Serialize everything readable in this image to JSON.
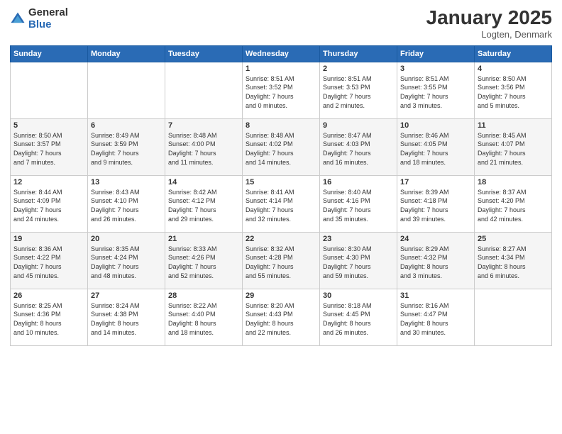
{
  "logo": {
    "general": "General",
    "blue": "Blue"
  },
  "header": {
    "title": "January 2025",
    "subtitle": "Logten, Denmark"
  },
  "days_of_week": [
    "Sunday",
    "Monday",
    "Tuesday",
    "Wednesday",
    "Thursday",
    "Friday",
    "Saturday"
  ],
  "weeks": [
    [
      {
        "day": "",
        "info": ""
      },
      {
        "day": "",
        "info": ""
      },
      {
        "day": "",
        "info": ""
      },
      {
        "day": "1",
        "info": "Sunrise: 8:51 AM\nSunset: 3:52 PM\nDaylight: 7 hours\nand 0 minutes."
      },
      {
        "day": "2",
        "info": "Sunrise: 8:51 AM\nSunset: 3:53 PM\nDaylight: 7 hours\nand 2 minutes."
      },
      {
        "day": "3",
        "info": "Sunrise: 8:51 AM\nSunset: 3:55 PM\nDaylight: 7 hours\nand 3 minutes."
      },
      {
        "day": "4",
        "info": "Sunrise: 8:50 AM\nSunset: 3:56 PM\nDaylight: 7 hours\nand 5 minutes."
      }
    ],
    [
      {
        "day": "5",
        "info": "Sunrise: 8:50 AM\nSunset: 3:57 PM\nDaylight: 7 hours\nand 7 minutes."
      },
      {
        "day": "6",
        "info": "Sunrise: 8:49 AM\nSunset: 3:59 PM\nDaylight: 7 hours\nand 9 minutes."
      },
      {
        "day": "7",
        "info": "Sunrise: 8:48 AM\nSunset: 4:00 PM\nDaylight: 7 hours\nand 11 minutes."
      },
      {
        "day": "8",
        "info": "Sunrise: 8:48 AM\nSunset: 4:02 PM\nDaylight: 7 hours\nand 14 minutes."
      },
      {
        "day": "9",
        "info": "Sunrise: 8:47 AM\nSunset: 4:03 PM\nDaylight: 7 hours\nand 16 minutes."
      },
      {
        "day": "10",
        "info": "Sunrise: 8:46 AM\nSunset: 4:05 PM\nDaylight: 7 hours\nand 18 minutes."
      },
      {
        "day": "11",
        "info": "Sunrise: 8:45 AM\nSunset: 4:07 PM\nDaylight: 7 hours\nand 21 minutes."
      }
    ],
    [
      {
        "day": "12",
        "info": "Sunrise: 8:44 AM\nSunset: 4:09 PM\nDaylight: 7 hours\nand 24 minutes."
      },
      {
        "day": "13",
        "info": "Sunrise: 8:43 AM\nSunset: 4:10 PM\nDaylight: 7 hours\nand 26 minutes."
      },
      {
        "day": "14",
        "info": "Sunrise: 8:42 AM\nSunset: 4:12 PM\nDaylight: 7 hours\nand 29 minutes."
      },
      {
        "day": "15",
        "info": "Sunrise: 8:41 AM\nSunset: 4:14 PM\nDaylight: 7 hours\nand 32 minutes."
      },
      {
        "day": "16",
        "info": "Sunrise: 8:40 AM\nSunset: 4:16 PM\nDaylight: 7 hours\nand 35 minutes."
      },
      {
        "day": "17",
        "info": "Sunrise: 8:39 AM\nSunset: 4:18 PM\nDaylight: 7 hours\nand 39 minutes."
      },
      {
        "day": "18",
        "info": "Sunrise: 8:37 AM\nSunset: 4:20 PM\nDaylight: 7 hours\nand 42 minutes."
      }
    ],
    [
      {
        "day": "19",
        "info": "Sunrise: 8:36 AM\nSunset: 4:22 PM\nDaylight: 7 hours\nand 45 minutes."
      },
      {
        "day": "20",
        "info": "Sunrise: 8:35 AM\nSunset: 4:24 PM\nDaylight: 7 hours\nand 48 minutes."
      },
      {
        "day": "21",
        "info": "Sunrise: 8:33 AM\nSunset: 4:26 PM\nDaylight: 7 hours\nand 52 minutes."
      },
      {
        "day": "22",
        "info": "Sunrise: 8:32 AM\nSunset: 4:28 PM\nDaylight: 7 hours\nand 55 minutes."
      },
      {
        "day": "23",
        "info": "Sunrise: 8:30 AM\nSunset: 4:30 PM\nDaylight: 7 hours\nand 59 minutes."
      },
      {
        "day": "24",
        "info": "Sunrise: 8:29 AM\nSunset: 4:32 PM\nDaylight: 8 hours\nand 3 minutes."
      },
      {
        "day": "25",
        "info": "Sunrise: 8:27 AM\nSunset: 4:34 PM\nDaylight: 8 hours\nand 6 minutes."
      }
    ],
    [
      {
        "day": "26",
        "info": "Sunrise: 8:25 AM\nSunset: 4:36 PM\nDaylight: 8 hours\nand 10 minutes."
      },
      {
        "day": "27",
        "info": "Sunrise: 8:24 AM\nSunset: 4:38 PM\nDaylight: 8 hours\nand 14 minutes."
      },
      {
        "day": "28",
        "info": "Sunrise: 8:22 AM\nSunset: 4:40 PM\nDaylight: 8 hours\nand 18 minutes."
      },
      {
        "day": "29",
        "info": "Sunrise: 8:20 AM\nSunset: 4:43 PM\nDaylight: 8 hours\nand 22 minutes."
      },
      {
        "day": "30",
        "info": "Sunrise: 8:18 AM\nSunset: 4:45 PM\nDaylight: 8 hours\nand 26 minutes."
      },
      {
        "day": "31",
        "info": "Sunrise: 8:16 AM\nSunset: 4:47 PM\nDaylight: 8 hours\nand 30 minutes."
      },
      {
        "day": "",
        "info": ""
      }
    ]
  ]
}
